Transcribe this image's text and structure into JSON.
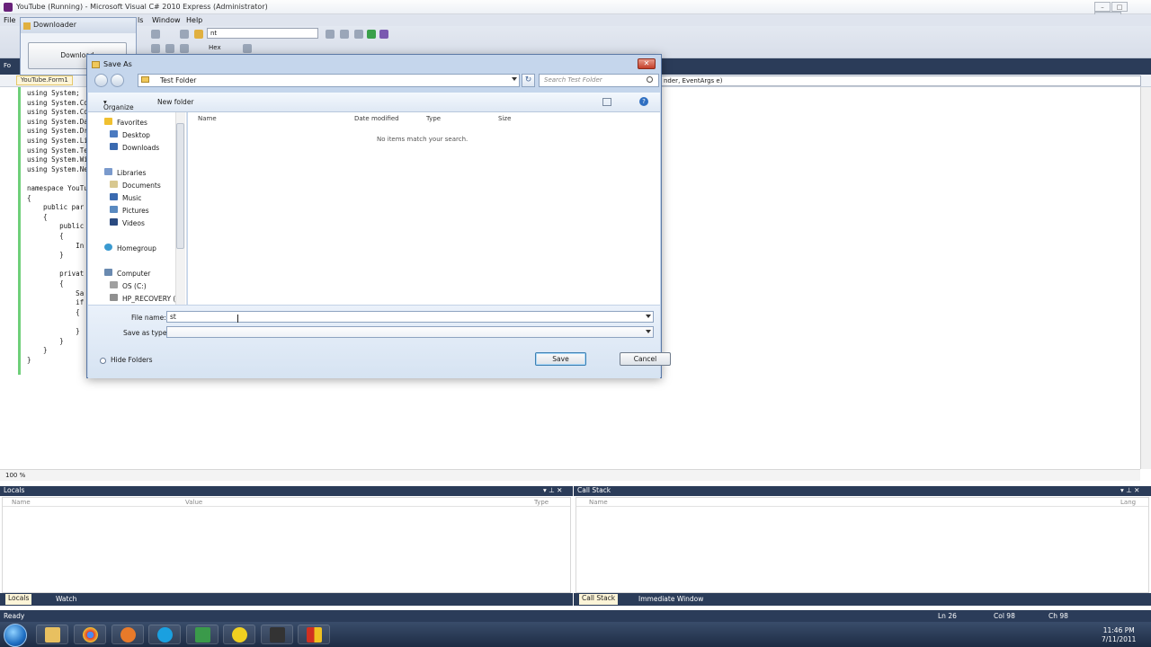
{
  "ide": {
    "title": "YouTube (Running) - Microsoft Visual C# 2010 Express (Administrator)",
    "menu": [
      "File",
      "ls",
      "Window",
      "Help"
    ],
    "toolbar_combo": "nt",
    "toolbar_hex": "Hex",
    "tab_label": "Fo",
    "file_tab": "YouTube.Form1",
    "nav_right": "nder, EventArgs e)",
    "code_lines": [
      "using System;",
      "using System.Co",
      "using System.Co",
      "using System.Da",
      "using System.Dr",
      "using System.Li",
      "using System.Te",
      "using System.Wi",
      "using System.Ne",
      "",
      "namespace YouTu",
      "{",
      "    public par",
      "    {",
      "        public",
      "        {",
      "            In",
      "        }",
      "",
      "        privat",
      "        {",
      "            Sa",
      "            if",
      "            {",
      "",
      "            }",
      "        }",
      "    }",
      "}"
    ],
    "zoom": "100 %",
    "locals_title": "Locals",
    "locals_cols": [
      "Name",
      "Value",
      "Type"
    ],
    "callstack_title": "Call Stack",
    "callstack_cols": [
      "Name",
      "Lang"
    ],
    "left_tabs": [
      "Locals",
      "Watch"
    ],
    "right_tabs": [
      "Call Stack",
      "Immediate Window"
    ],
    "status": {
      "text": "Ready",
      "ln": "Ln 26",
      "col": "Col 98",
      "ch": "Ch 98"
    }
  },
  "downloader": {
    "title": "Downloader",
    "button": "Download"
  },
  "dialog": {
    "title": "Save As",
    "address": "Test Folder",
    "search_placeholder": "Search Test Folder",
    "organize": "Organize",
    "new_folder": "New folder",
    "nav": {
      "favorites": "Favorites",
      "desktop": "Desktop",
      "downloads": "Downloads",
      "libraries": "Libraries",
      "documents": "Documents",
      "music": "Music",
      "pictures": "Pictures",
      "videos": "Videos",
      "homegroup": "Homegroup",
      "computer": "Computer",
      "os": "OS (C:)",
      "recovery": "HP_RECOVERY (D"
    },
    "columns": {
      "name": "Name",
      "date": "Date modified",
      "type": "Type",
      "size": "Size"
    },
    "empty_message": "No items match your search.",
    "file_name_label": "File name:",
    "file_name_value": "st",
    "save_as_type_label": "Save as type:",
    "save_as_type_value": "",
    "hide_folders": "Hide Folders",
    "save_button": "Save",
    "cancel_button": "Cancel"
  },
  "taskbar": {
    "time": "11:46 PM",
    "date": "7/11/2011"
  }
}
